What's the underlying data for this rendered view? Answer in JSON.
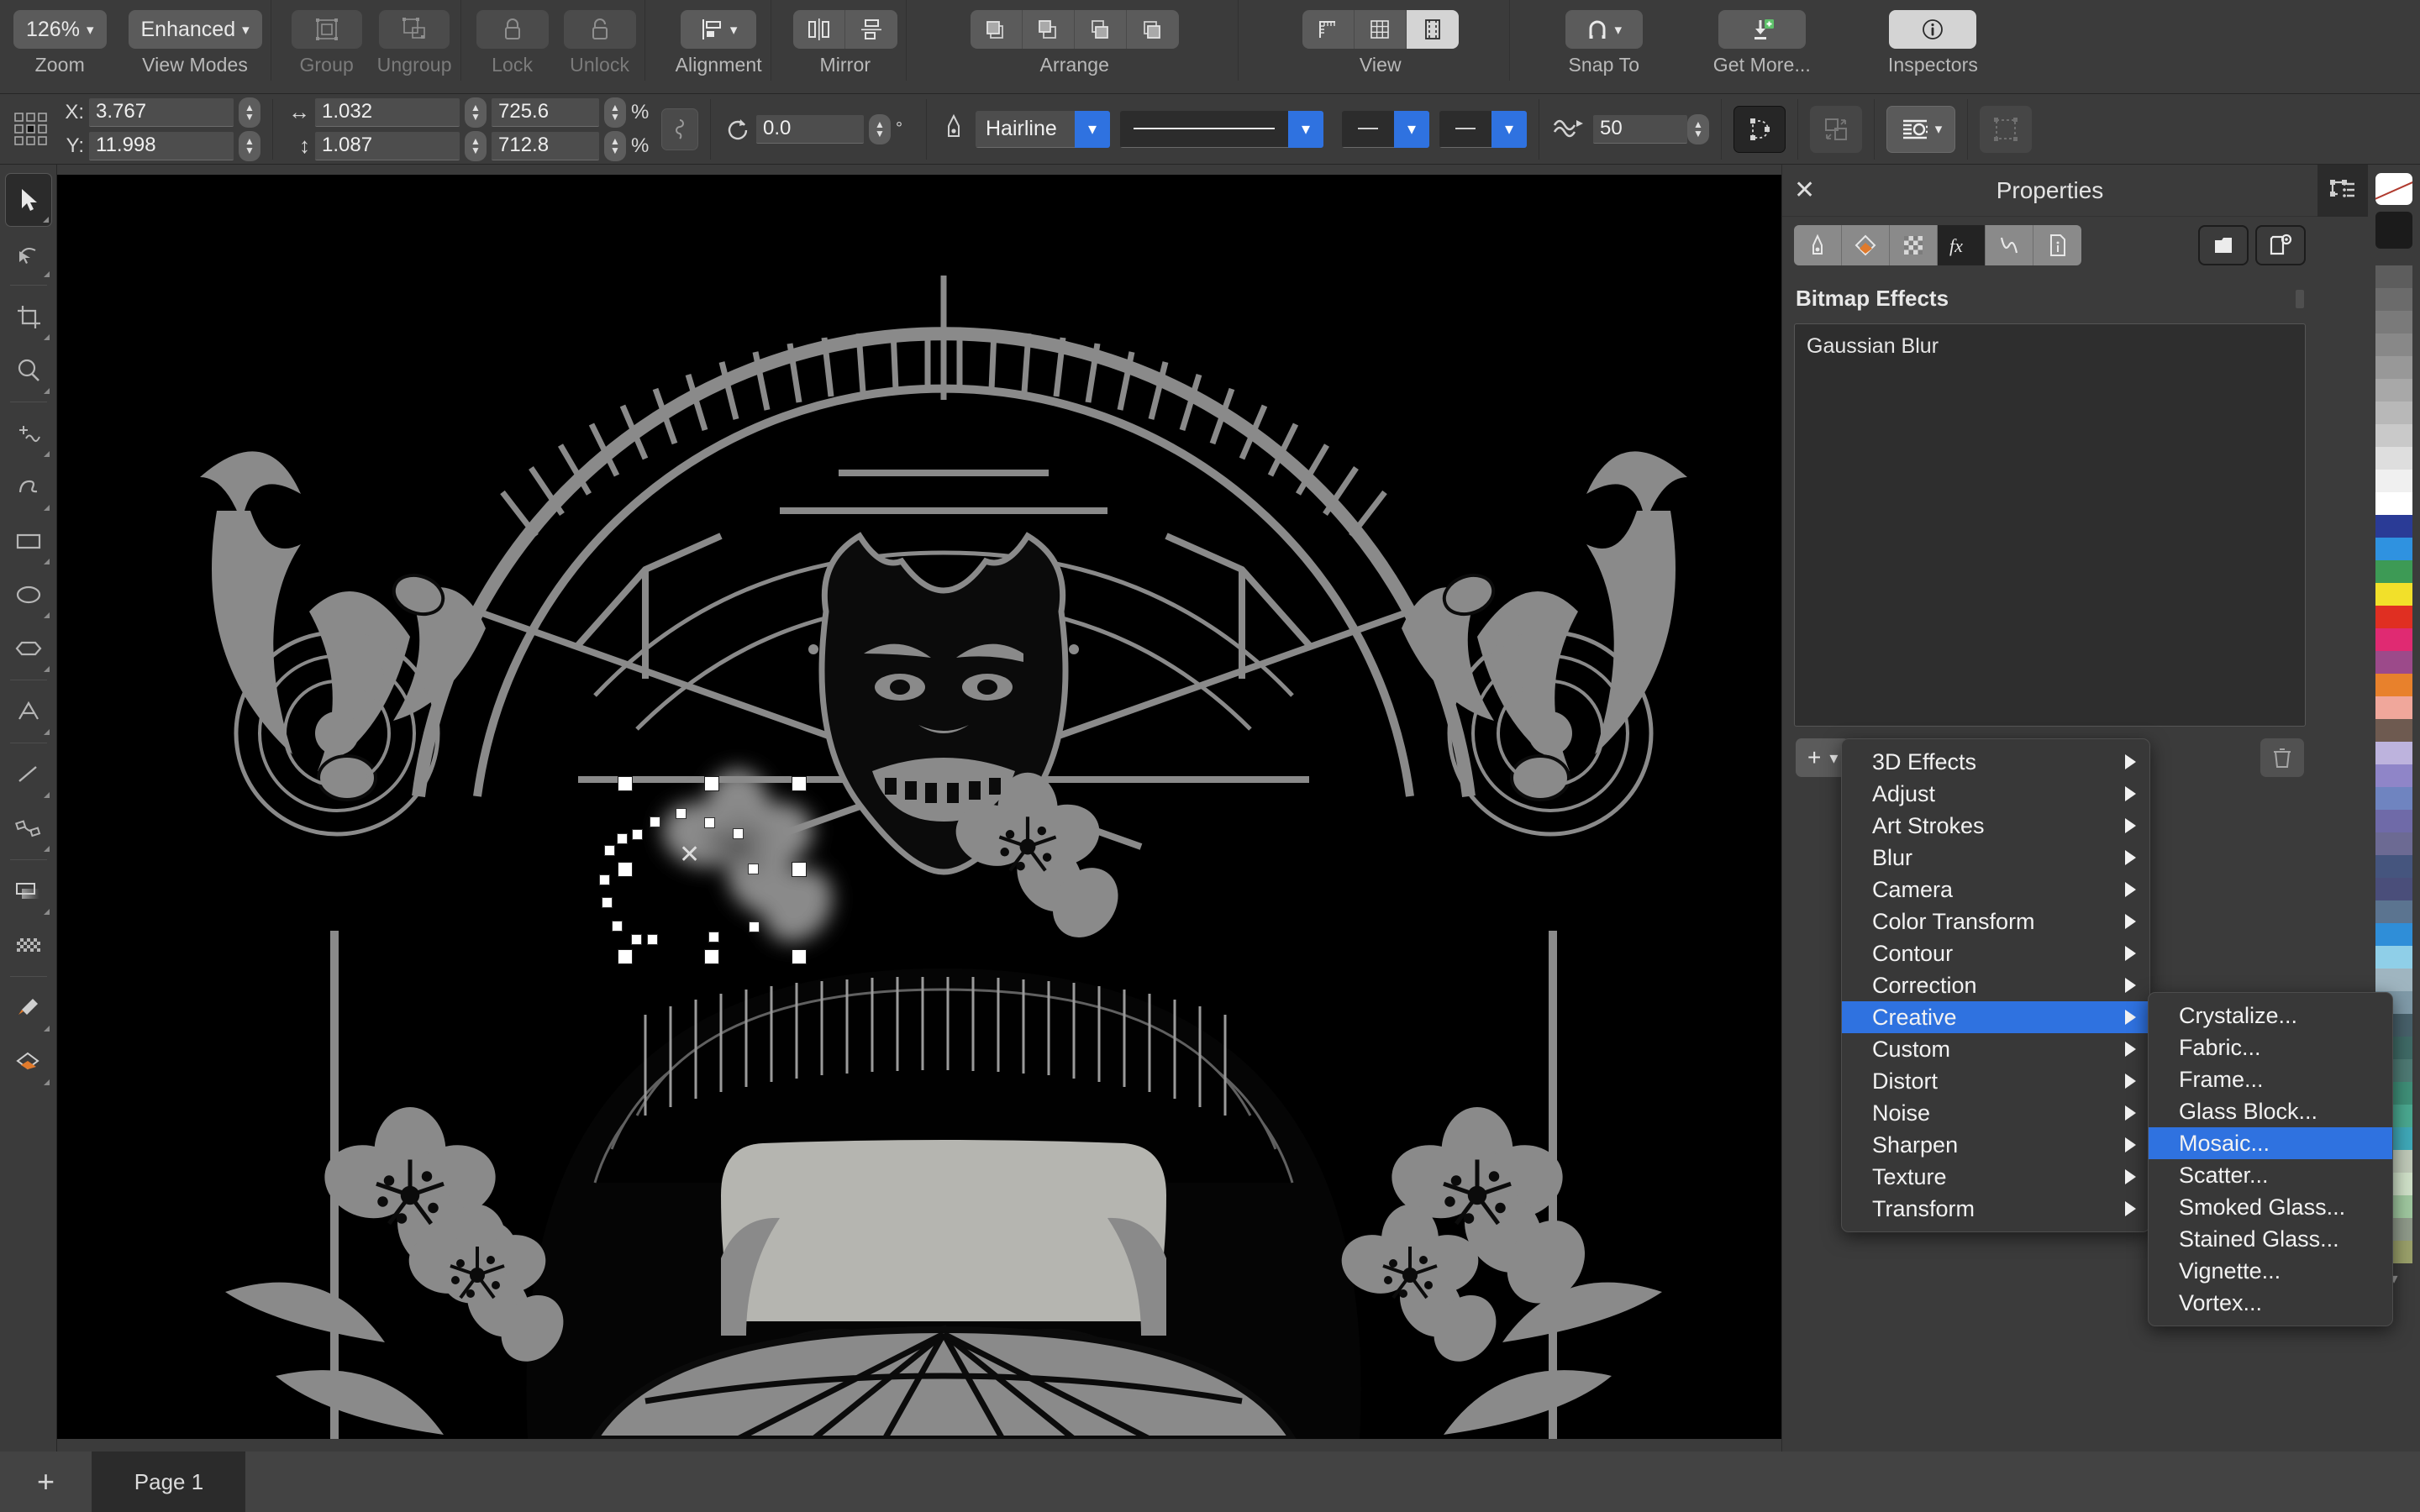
{
  "ribbon": {
    "groups": [
      {
        "caption": "Zoom",
        "caption_dim": false,
        "value": "126%"
      },
      {
        "caption": "View Modes",
        "caption_dim": false,
        "value": "Enhanced"
      },
      {
        "caption": "Group",
        "caption_dim": true
      },
      {
        "caption": "Ungroup",
        "caption_dim": true
      },
      {
        "caption": "Lock",
        "caption_dim": true
      },
      {
        "caption": "Unlock",
        "caption_dim": true
      },
      {
        "caption": "Alignment",
        "caption_dim": false
      },
      {
        "caption": "Mirror",
        "caption_dim": false
      },
      {
        "caption": "Arrange",
        "caption_dim": false
      },
      {
        "caption": "View",
        "caption_dim": false
      },
      {
        "caption": "Snap To",
        "caption_dim": false
      },
      {
        "caption": "Get More...",
        "caption_dim": false
      },
      {
        "caption": "Inspectors",
        "caption_dim": false
      }
    ]
  },
  "propbar": {
    "x_label": "X:",
    "y_label": "Y:",
    "x_value": "3.767",
    "y_value": "11.998",
    "width_value": "1.032",
    "height_value": "1.087",
    "width_pct": "725.6",
    "height_pct": "712.8",
    "pct_symbol": "%",
    "rotation_value": "0.0",
    "rotation_unit": "°",
    "outline_width": "Hairline",
    "transparency_value": "50"
  },
  "toolbox": {
    "tools": [
      "selector-tool",
      "shape-edit-tool",
      "crop-tool",
      "zoom-tool",
      "freehand-tool",
      "smart-draw-tool",
      "rectangle-tool",
      "ellipse-tool",
      "polygon-tool",
      "text-tool",
      "straight-line-tool",
      "connector-tool",
      "drop-shadow-tool",
      "transparency-tool",
      "color-eyedropper-tool",
      "fill-tool"
    ]
  },
  "dock": {
    "title": "Properties",
    "close_label": "✕",
    "tabs": [
      {
        "name": "outline-tab",
        "active": false
      },
      {
        "name": "fill-tab",
        "active": false
      },
      {
        "name": "transparency-tab",
        "active": false
      },
      {
        "name": "effects-tab",
        "active": true
      },
      {
        "name": "curve-tab",
        "active": false
      },
      {
        "name": "document-info-tab",
        "active": false
      }
    ],
    "section_title": "Bitmap Effects",
    "effects": [
      "Gaussian Blur"
    ],
    "add_label": "+",
    "add_chevron": "⌄"
  },
  "menu_main": {
    "items": [
      {
        "label": "3D Effects",
        "selected": false
      },
      {
        "label": "Adjust",
        "selected": false
      },
      {
        "label": "Art Strokes",
        "selected": false
      },
      {
        "label": "Blur",
        "selected": false
      },
      {
        "label": "Camera",
        "selected": false
      },
      {
        "label": "Color Transform",
        "selected": false
      },
      {
        "label": "Contour",
        "selected": false
      },
      {
        "label": "Correction",
        "selected": false
      },
      {
        "label": "Creative",
        "selected": true
      },
      {
        "label": "Custom",
        "selected": false
      },
      {
        "label": "Distort",
        "selected": false
      },
      {
        "label": "Noise",
        "selected": false
      },
      {
        "label": "Sharpen",
        "selected": false
      },
      {
        "label": "Texture",
        "selected": false
      },
      {
        "label": "Transform",
        "selected": false
      }
    ]
  },
  "menu_sub": {
    "items": [
      {
        "label": "Crystalize...",
        "selected": false
      },
      {
        "label": "Fabric...",
        "selected": false
      },
      {
        "label": "Frame...",
        "selected": false
      },
      {
        "label": "Glass Block...",
        "selected": false
      },
      {
        "label": "Mosaic...",
        "selected": true
      },
      {
        "label": "Scatter...",
        "selected": false
      },
      {
        "label": "Smoked Glass...",
        "selected": false
      },
      {
        "label": "Stained Glass...",
        "selected": false
      },
      {
        "label": "Vignette...",
        "selected": false
      },
      {
        "label": "Vortex...",
        "selected": false
      }
    ]
  },
  "pagebar": {
    "add_page_label": "+",
    "page_label": "Page 1"
  },
  "palette": {
    "colors": [
      "#5d5d5d",
      "#6b6b6b",
      "#7a7a7a",
      "#888888",
      "#989898",
      "#a8a8a8",
      "#b8b8b8",
      "#c9c9c9",
      "#dedede",
      "#f0f0f0",
      "#ffffff",
      "#2a3b96",
      "#2f92e0",
      "#3d9a55",
      "#f2e02a",
      "#e02f22",
      "#e02a72",
      "#9c4a8a",
      "#e8812c",
      "#f0a79b",
      "#6e5a50",
      "#bdb3dd",
      "#8f85c8",
      "#6f84c0",
      "#6f6aa8",
      "#6c6a93",
      "#45557e",
      "#4a4e7a",
      "#5b7490",
      "#2f8ed8",
      "#8fcfe8",
      "#9fb5c0",
      "#7f9aa8",
      "#47606a",
      "#3f6a66",
      "#4e7a74",
      "#3f8f78",
      "#4aa890",
      "#3fa8b8",
      "#bfc9b8",
      "#cfe0c8",
      "#9fc79f",
      "#8f9a8a",
      "#9aa06a"
    ]
  },
  "colors": {
    "accent_blue": "#2f72e0",
    "menu_bg": "#383838",
    "panel_bg": "#3b3b3b",
    "canvas_bg": "#000000",
    "art_gray": "#8a8a8a"
  }
}
